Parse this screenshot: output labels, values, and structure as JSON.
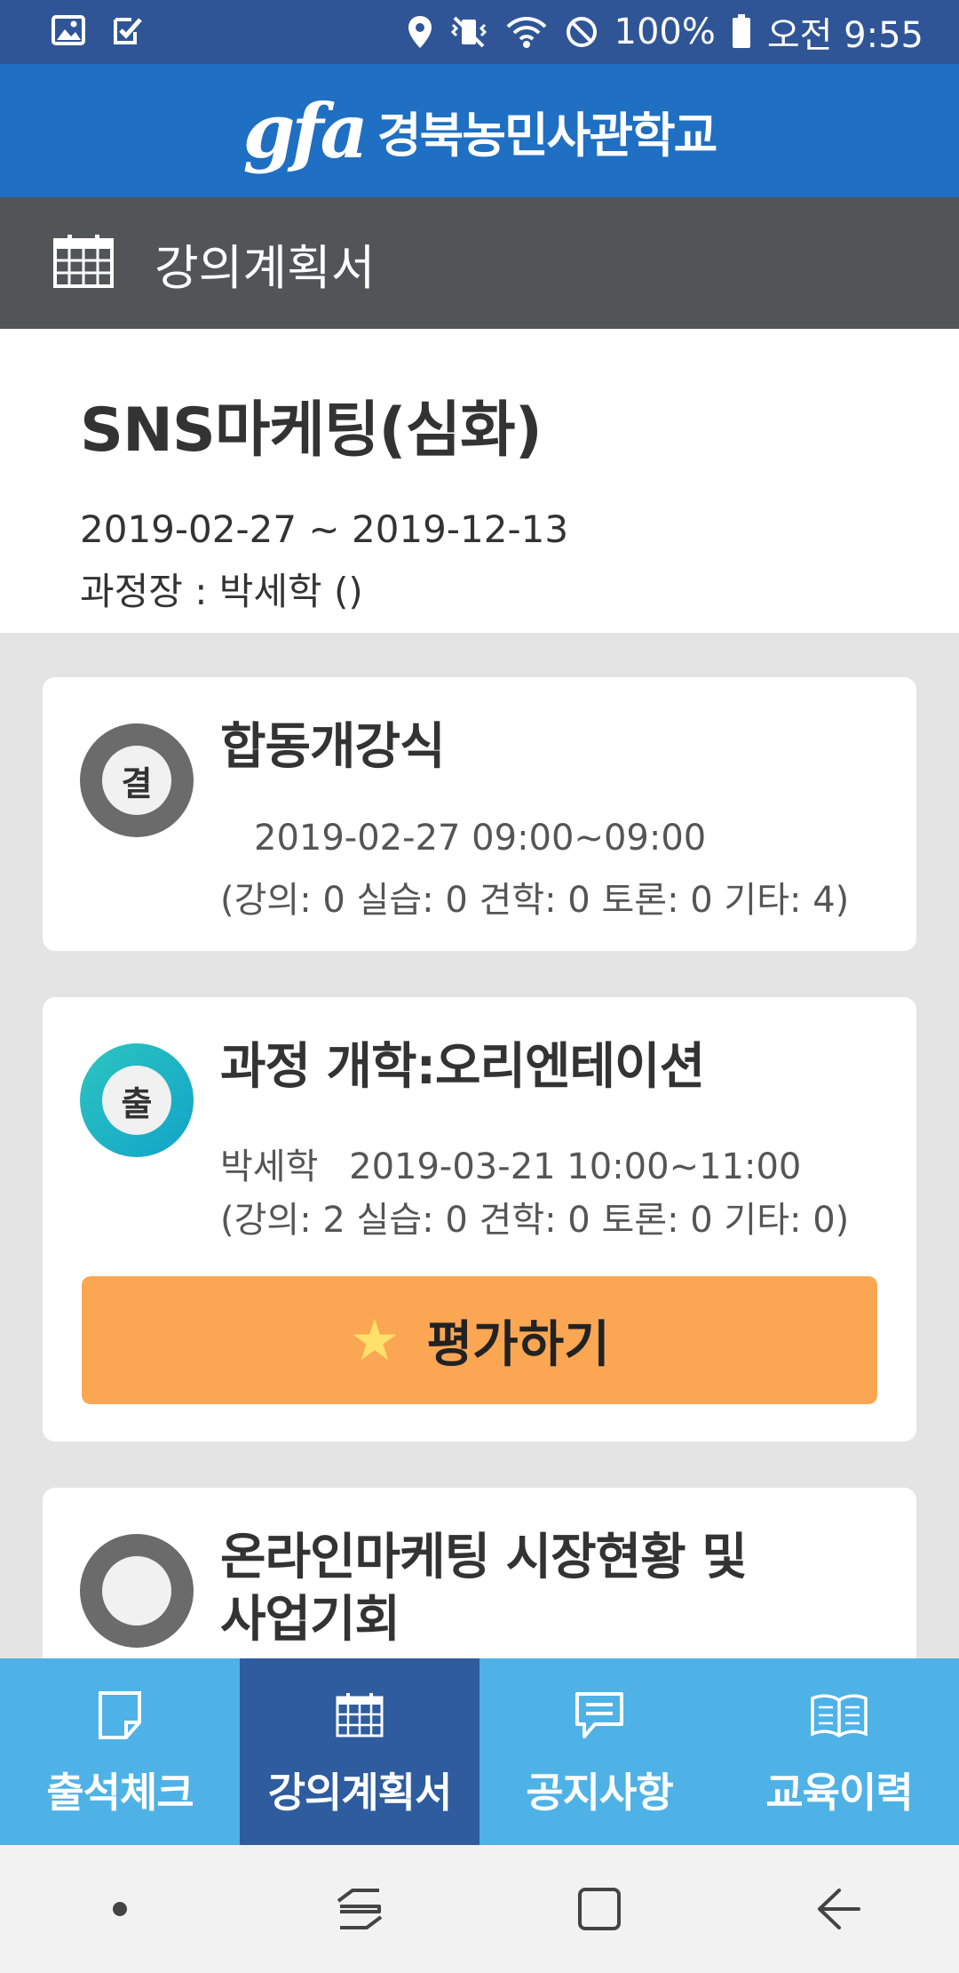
{
  "status_bar": {
    "left_icons": [
      "image-icon",
      "check-clipboard-icon"
    ],
    "right_icons": [
      "location-icon",
      "vibrate-icon",
      "wifi-icon",
      "blocked-icon",
      "battery-icon"
    ],
    "battery": "100%",
    "time": "오전 9:55"
  },
  "brand": {
    "logo": "gfa",
    "name": "경북농민사관학교",
    "color": "#1f6fc3"
  },
  "section_header": {
    "icon": "calendar-icon",
    "title": "강의계획서"
  },
  "course": {
    "title": "SNS마케팅(심화)",
    "dates": "2019-02-27 ~ 2019-12-13",
    "manager": "과정장 : 박세학 ()"
  },
  "lectures": [
    {
      "status": "결",
      "title": "합동개강식",
      "instructor": "",
      "datetime": "2019-02-27 09:00~09:00",
      "counts": "(강의: 0 실습: 0 견학: 0 토론: 0 기타: 4)"
    },
    {
      "status": "출",
      "title": "과정 개학:오리엔테이션",
      "instructor": "박세학",
      "datetime": "2019-03-21 10:00~11:00",
      "counts": "(강의: 2 실습: 0 견학: 0 토론: 0 기타: 0)",
      "action": "평가하기"
    },
    {
      "status": "",
      "title_line1": "온라인마케팅 시장현황 및",
      "title_line2": "사업기회"
    }
  ],
  "bottom_nav": [
    {
      "label": "출석체크",
      "icon": "note-icon",
      "active": false
    },
    {
      "label": "강의계획서",
      "icon": "calendar-icon",
      "active": true
    },
    {
      "label": "공지사항",
      "icon": "chat-bubble-icon",
      "active": false
    },
    {
      "label": "교육이력",
      "icon": "open-book-icon",
      "active": false
    }
  ],
  "colors": {
    "status_bar": "#2f5597",
    "header_gray": "#515558",
    "eval_button": "#fba653",
    "nav_bg": "#4fb2e6",
    "nav_active": "#2e5c9e",
    "present_ring": "#1eb4c4",
    "absent_ring": "#6b6b6b"
  }
}
